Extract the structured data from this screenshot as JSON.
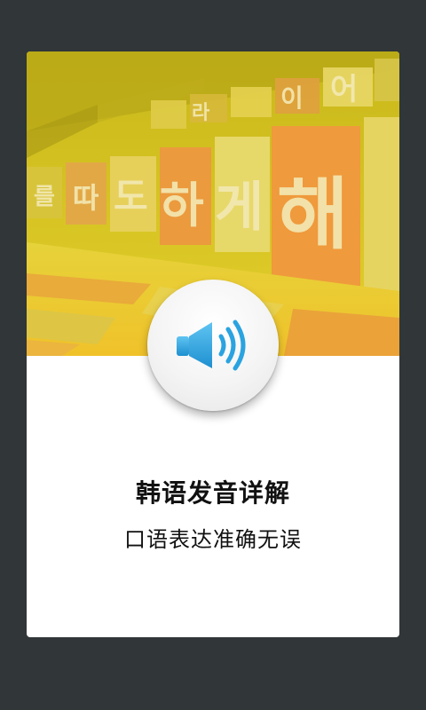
{
  "card": {
    "title": "韩语发音详解",
    "subtitle": "口语表达准确无误"
  },
  "hero": {
    "tiles": [
      "하",
      "게",
      "해",
      "도",
      "라",
      "이",
      "어",
      "따",
      "를"
    ]
  },
  "icons": {
    "play": "speaker-icon"
  },
  "colors": {
    "background": "#313638",
    "card": "#ffffff",
    "hero_tint": "#d9c21a",
    "speaker_blue": "#2aa3e0"
  }
}
